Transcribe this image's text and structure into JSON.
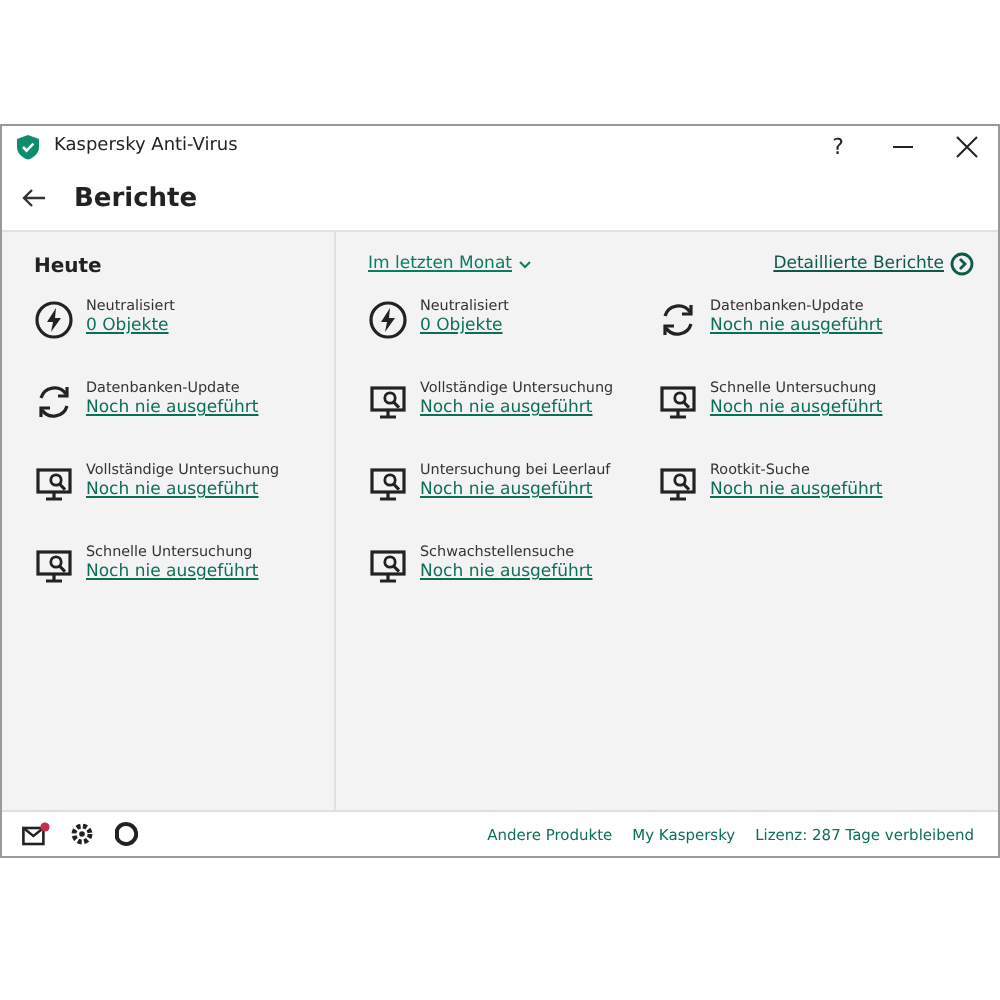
{
  "window": {
    "title": "Kaspersky Anti-Virus",
    "help": "?"
  },
  "header": {
    "title": "Berichte"
  },
  "today": {
    "heading": "Heute",
    "items": [
      {
        "kind": "threat",
        "label": "Neutralisiert",
        "value": "0 Objekte"
      },
      {
        "kind": "update",
        "label": "Datenbanken-Update",
        "value": "Noch nie ausgeführt"
      },
      {
        "kind": "scan",
        "label": "Vollständige Untersuchung",
        "value": "Noch nie ausgeführt"
      },
      {
        "kind": "scan",
        "label": "Schnelle Untersuchung",
        "value": "Noch nie ausgeführt"
      }
    ]
  },
  "period": {
    "selector": "Im letzten Monat",
    "details_link": "Detaillierte Berichte",
    "items": [
      {
        "kind": "threat",
        "label": "Neutralisiert",
        "value": "0 Objekte"
      },
      {
        "kind": "update",
        "label": "Datenbanken-Update",
        "value": "Noch nie ausgeführt"
      },
      {
        "kind": "scan",
        "label": "Vollständige Untersuchung",
        "value": "Noch nie ausgeführt"
      },
      {
        "kind": "scan",
        "label": "Schnelle Untersuchung",
        "value": "Noch nie ausgeführt"
      },
      {
        "kind": "scan",
        "label": "Untersuchung bei Leerlauf",
        "value": "Noch nie ausgeführt"
      },
      {
        "kind": "scan",
        "label": "Rootkit-Suche",
        "value": "Noch nie ausgeführt"
      },
      {
        "kind": "scan",
        "label": "Schwachstellensuche",
        "value": "Noch nie ausgeführt"
      }
    ]
  },
  "footer": {
    "links": [
      "Andere Produkte",
      "My Kaspersky",
      "Lizenz: 287 Tage verbleibend"
    ]
  }
}
